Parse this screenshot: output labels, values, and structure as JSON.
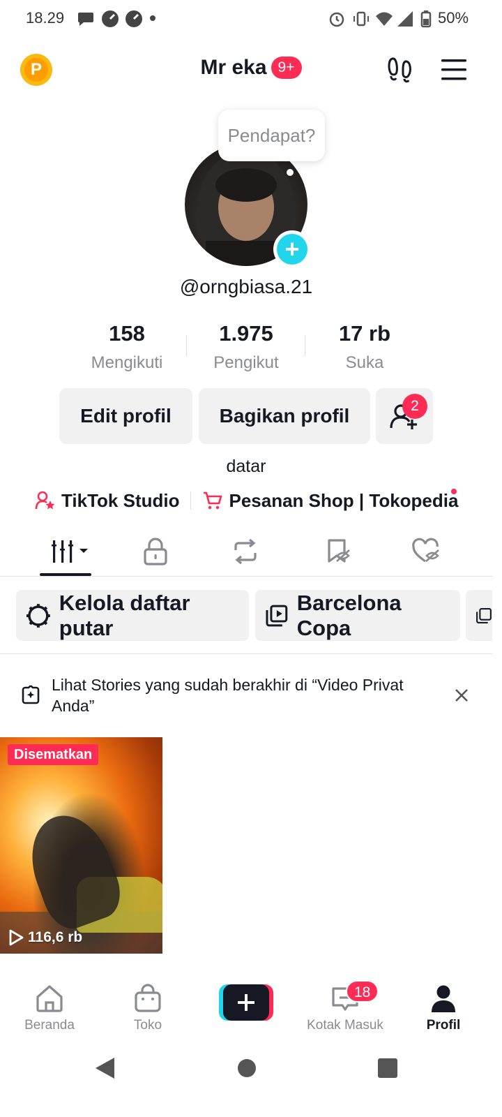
{
  "status_bar": {
    "time": "18.29",
    "battery": "50%"
  },
  "header": {
    "name": "Mr eka",
    "notification_badge": "9+",
    "points_letter": "P"
  },
  "profile": {
    "bubble_text": "Pendapat?",
    "username": "@orngbiasa.21",
    "stats": [
      {
        "value": "158",
        "label": "Mengikuti"
      },
      {
        "value": "1.975",
        "label": "Pengikut"
      },
      {
        "value": "17 rb",
        "label": "Suka"
      }
    ],
    "edit_button": "Edit profil",
    "share_button": "Bagikan profil",
    "add_friend_count": "2",
    "bio": "datar",
    "links": {
      "studio": "TikTok Studio",
      "shop": "Pesanan Shop | Tokopedia"
    }
  },
  "playlists": {
    "manage": "Kelola daftar putar",
    "item1": "Barcelona Copa"
  },
  "stories_notice": {
    "text": "Lihat Stories yang sudah berakhir di “Video Privat Anda”"
  },
  "video": {
    "pinned_label": "Disematkan",
    "views": "116,6 rb"
  },
  "bottom_nav": {
    "home": "Beranda",
    "shop": "Toko",
    "inbox": "Kotak Masuk",
    "inbox_badge": "18",
    "profile": "Profil"
  },
  "colors": {
    "accent": "#fe2c55",
    "teal": "#20d5ec",
    "text": "#161823",
    "muted": "#8a8b91"
  }
}
